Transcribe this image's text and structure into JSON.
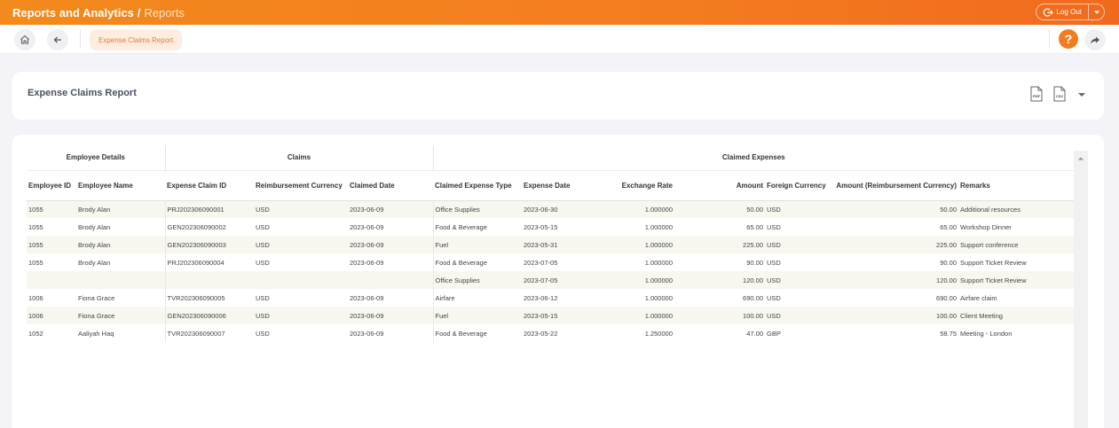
{
  "topbar": {
    "section": "Reports and Analytics",
    "separator": "/",
    "page": "Reports",
    "logout_label": "Log Out"
  },
  "nav": {
    "tab_label": "Expense Claims Report",
    "help_label": "?"
  },
  "report": {
    "title": "Expense Claims Report",
    "export_pdf": "PDF",
    "export_csv": "CSV"
  },
  "table": {
    "groups": [
      "Employee Details",
      "Claims",
      "Claimed Expenses"
    ],
    "columns": [
      "Employee ID",
      "Employee Name",
      "Expense Claim ID",
      "Reimbursement Currency",
      "Claimed Date",
      "Claimed Expense Type",
      "Expense Date",
      "Exchange Rate",
      "Amount",
      "Foreign Currency",
      "Amount (Reimbursement Currency)",
      "Remarks"
    ],
    "rows": [
      [
        "1055",
        "Brody Alan",
        "PRJ202306090001",
        "USD",
        "2023-06-09",
        "Office Supplies",
        "2023-06-30",
        "1.000000",
        "50.00",
        "USD",
        "50.00",
        "Additional resources"
      ],
      [
        "1055",
        "Brody Alan",
        "GEN202306090002",
        "USD",
        "2023-06-09",
        "Food & Beverage",
        "2023-05-15",
        "1.000000",
        "65.00",
        "USD",
        "65.00",
        "Workshop Dinner"
      ],
      [
        "1055",
        "Brody Alan",
        "GEN202306090003",
        "USD",
        "2023-06-09",
        "Fuel",
        "2023-05-31",
        "1.000000",
        "225.00",
        "USD",
        "225.00",
        "Support conference"
      ],
      [
        "1055",
        "Brody Alan",
        "PRJ202306090004",
        "USD",
        "2023-06-09",
        "Food & Beverage",
        "2023-07-05",
        "1.000000",
        "90.00",
        "USD",
        "90.00",
        "Support Ticket Review"
      ],
      [
        "",
        "",
        "",
        "",
        "",
        "Office Supplies",
        "2023-07-05",
        "1.000000",
        "120.00",
        "USD",
        "120.00",
        "Support Ticket Review"
      ],
      [
        "1006",
        "Fiona Grace",
        "TVR202306090005",
        "USD",
        "2023-06-09",
        "Airfare",
        "2023-06-12",
        "1.000000",
        "690.00",
        "USD",
        "690.00",
        "Airfare claim"
      ],
      [
        "1006",
        "Fiona Grace",
        "GEN202306090006",
        "USD",
        "2023-06-09",
        "Fuel",
        "2023-05-15",
        "1.000000",
        "100.00",
        "USD",
        "100.00",
        "Client Meeting"
      ],
      [
        "1052",
        "Aaliyah Haq",
        "TVR202306090007",
        "USD",
        "2023-06-09",
        "Food & Beverage",
        "2023-05-22",
        "1.250000",
        "47.00",
        "GBP",
        "58.75",
        "Meeting - London"
      ]
    ]
  },
  "icons": {
    "home": "home-icon",
    "back": "arrow-left-icon",
    "help": "question-icon",
    "share": "share-arrow-icon",
    "logout": "logout-icon"
  },
  "colors": {
    "accent": "#f47c20",
    "chip_bg": "#fdece0",
    "row_stripe": "#f7f7ef"
  }
}
